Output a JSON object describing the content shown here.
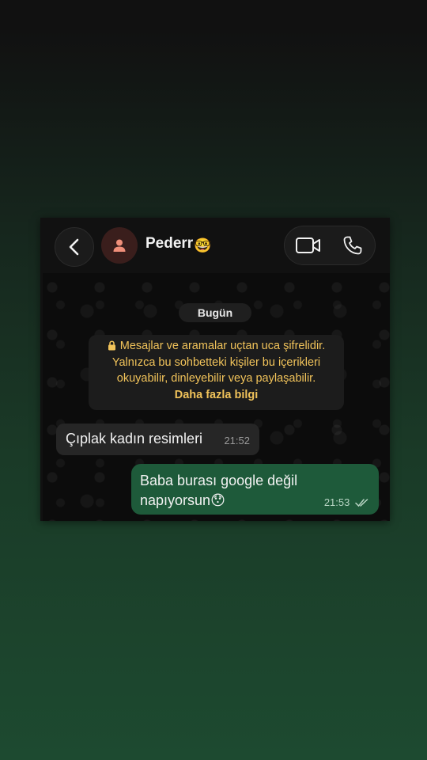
{
  "header": {
    "contact_name": "Pederr",
    "contact_emoji": "🤓"
  },
  "chat": {
    "date_label": "Bugün",
    "encryption_notice": {
      "line1": "Mesajlar ve aramalar uçtan uca şifrelidir.",
      "line2": "Yalnızca bu sohbetteki kişiler bu içerikleri",
      "line3": "okuyabilir, dinleyebilir veya paylaşabilir.",
      "link": "Daha fazla bilgi"
    },
    "messages": [
      {
        "direction": "incoming",
        "text": "Çıplak kadın resimleri",
        "time": "21:52"
      },
      {
        "direction": "outgoing",
        "line1": "Baba burası google değil",
        "line2": "napıyorsun",
        "emoji": "😯",
        "time": "21:53",
        "status": "read"
      }
    ]
  },
  "colors": {
    "outgoing_bubble": "#1e5a3a",
    "incoming_bubble": "#262626",
    "notice_text": "#f1c35a",
    "avatar_bg": "#3a1e1c",
    "avatar_icon": "#f08f7a"
  }
}
